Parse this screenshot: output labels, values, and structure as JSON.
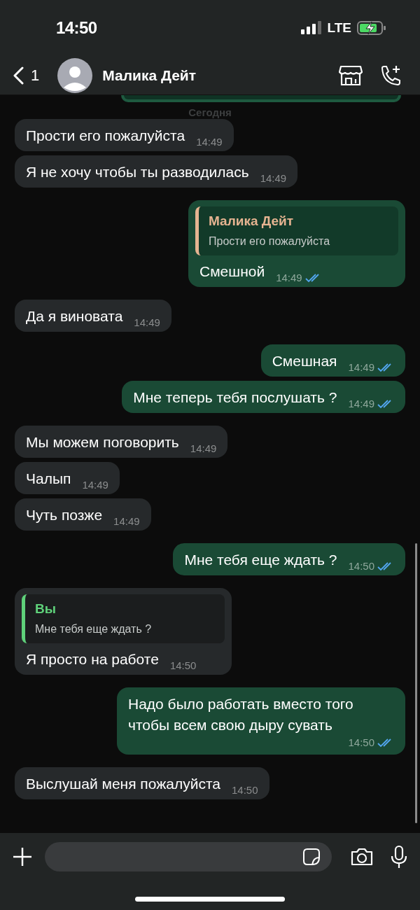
{
  "status_bar": {
    "time": "14:50",
    "network": "LTE",
    "charging": true
  },
  "header": {
    "back_count": "1",
    "contact_name": "Малика Дейт"
  },
  "date_label": "Сегодня",
  "messages": [
    {
      "kind": "incoming",
      "text": "Прости его пожалуйста",
      "time": "14:49"
    },
    {
      "kind": "incoming",
      "text": "Я не хочу чтобы ты разводилась",
      "time": "14:49"
    },
    {
      "kind": "outgoing",
      "text": "Смешной",
      "time": "14:49",
      "read": true,
      "quote": {
        "author": "Малика Дейт",
        "text": "Прости его пожалуйста",
        "color": "#e6b491"
      }
    },
    {
      "kind": "incoming",
      "text": "Да я виновата",
      "time": "14:49"
    },
    {
      "kind": "outgoing",
      "text": "Смешная",
      "time": "14:49",
      "read": true
    },
    {
      "kind": "outgoing",
      "text": "Мне теперь тебя послушать ?",
      "time": "14:49",
      "read": true
    },
    {
      "kind": "incoming",
      "text": "Мы можем поговорить",
      "time": "14:49"
    },
    {
      "kind": "incoming",
      "text": "Чалып",
      "time": "14:49"
    },
    {
      "kind": "incoming",
      "text": "Чуть позже",
      "time": "14:49"
    },
    {
      "kind": "outgoing",
      "text": "Мне тебя еще ждать ?",
      "time": "14:50",
      "read": true
    },
    {
      "kind": "incoming",
      "text": "Я просто на работе",
      "time": "14:50",
      "quote": {
        "author": "Вы",
        "text": "Мне тебя еще ждать ?",
        "color": "#5fd17a"
      }
    },
    {
      "kind": "outgoing",
      "text": "Надо было работать вместо того чтобы всем свою дыру сувать",
      "time": "14:50",
      "read": true
    },
    {
      "kind": "incoming",
      "text": "Выслушай меня пожалуйста",
      "time": "14:50"
    }
  ]
}
